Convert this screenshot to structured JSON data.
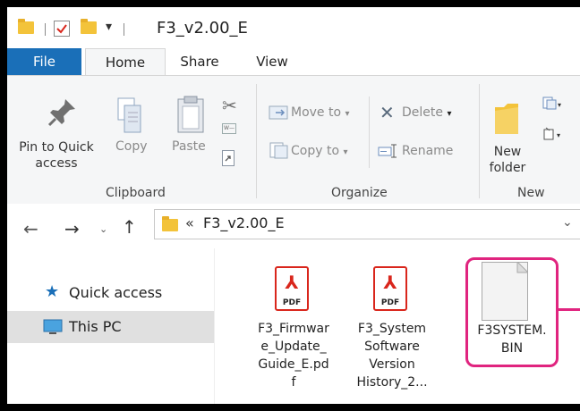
{
  "window": {
    "title": "F3_v2.00_E"
  },
  "tabs": [
    "File",
    "Home",
    "Share",
    "View"
  ],
  "ribbon": {
    "pin_label_1": "Pin to Quick",
    "pin_label_2": "access",
    "copy": "Copy",
    "paste": "Paste",
    "clipboard_group": "Clipboard",
    "move_to": "Move to",
    "copy_to": "Copy to",
    "delete": "Delete",
    "rename": "Rename",
    "organize_group": "Organize",
    "new_folder_1": "New",
    "new_folder_2": "folder",
    "new_group": "New"
  },
  "address": {
    "prefix": "«",
    "path": "F3_v2.00_E"
  },
  "sidebar": {
    "items": [
      "Quick access",
      "This PC"
    ]
  },
  "files": [
    {
      "type": "PDF",
      "lines": [
        "F3_Firmwar",
        "e_Update_",
        "Guide_E.pd",
        "f"
      ]
    },
    {
      "type": "PDF",
      "lines": [
        "F3_System",
        "Software",
        "Version",
        "History_2..."
      ]
    },
    {
      "type": "BIN",
      "lines": [
        "F3SYSTEM.",
        "BIN"
      ]
    }
  ],
  "colors": {
    "file_tab": "#1a6fb8",
    "highlight": "#e0247f",
    "pdf_red": "#d9261c"
  }
}
